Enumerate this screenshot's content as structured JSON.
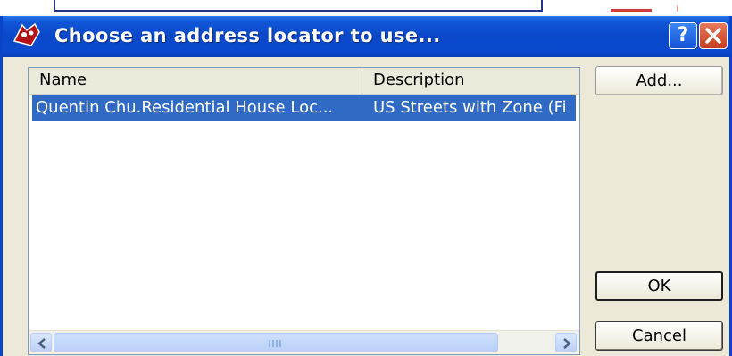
{
  "dialog": {
    "title": "Choose an address locator to use...",
    "help_label": "?",
    "icon": "address-locator-icon"
  },
  "list": {
    "columns": [
      "Name",
      "Description"
    ],
    "rows": [
      {
        "name": "Quentin Chu.Residential House Loc...",
        "description": "US Streets with Zone (Fi",
        "selected": true
      }
    ],
    "scroll_grip": "IIII"
  },
  "buttons": {
    "add": "Add...",
    "ok": "OK",
    "cancel": "Cancel"
  },
  "colors": {
    "titlebar": "#0a48c8",
    "selection": "#316ac5",
    "close": "#c63d1a"
  }
}
